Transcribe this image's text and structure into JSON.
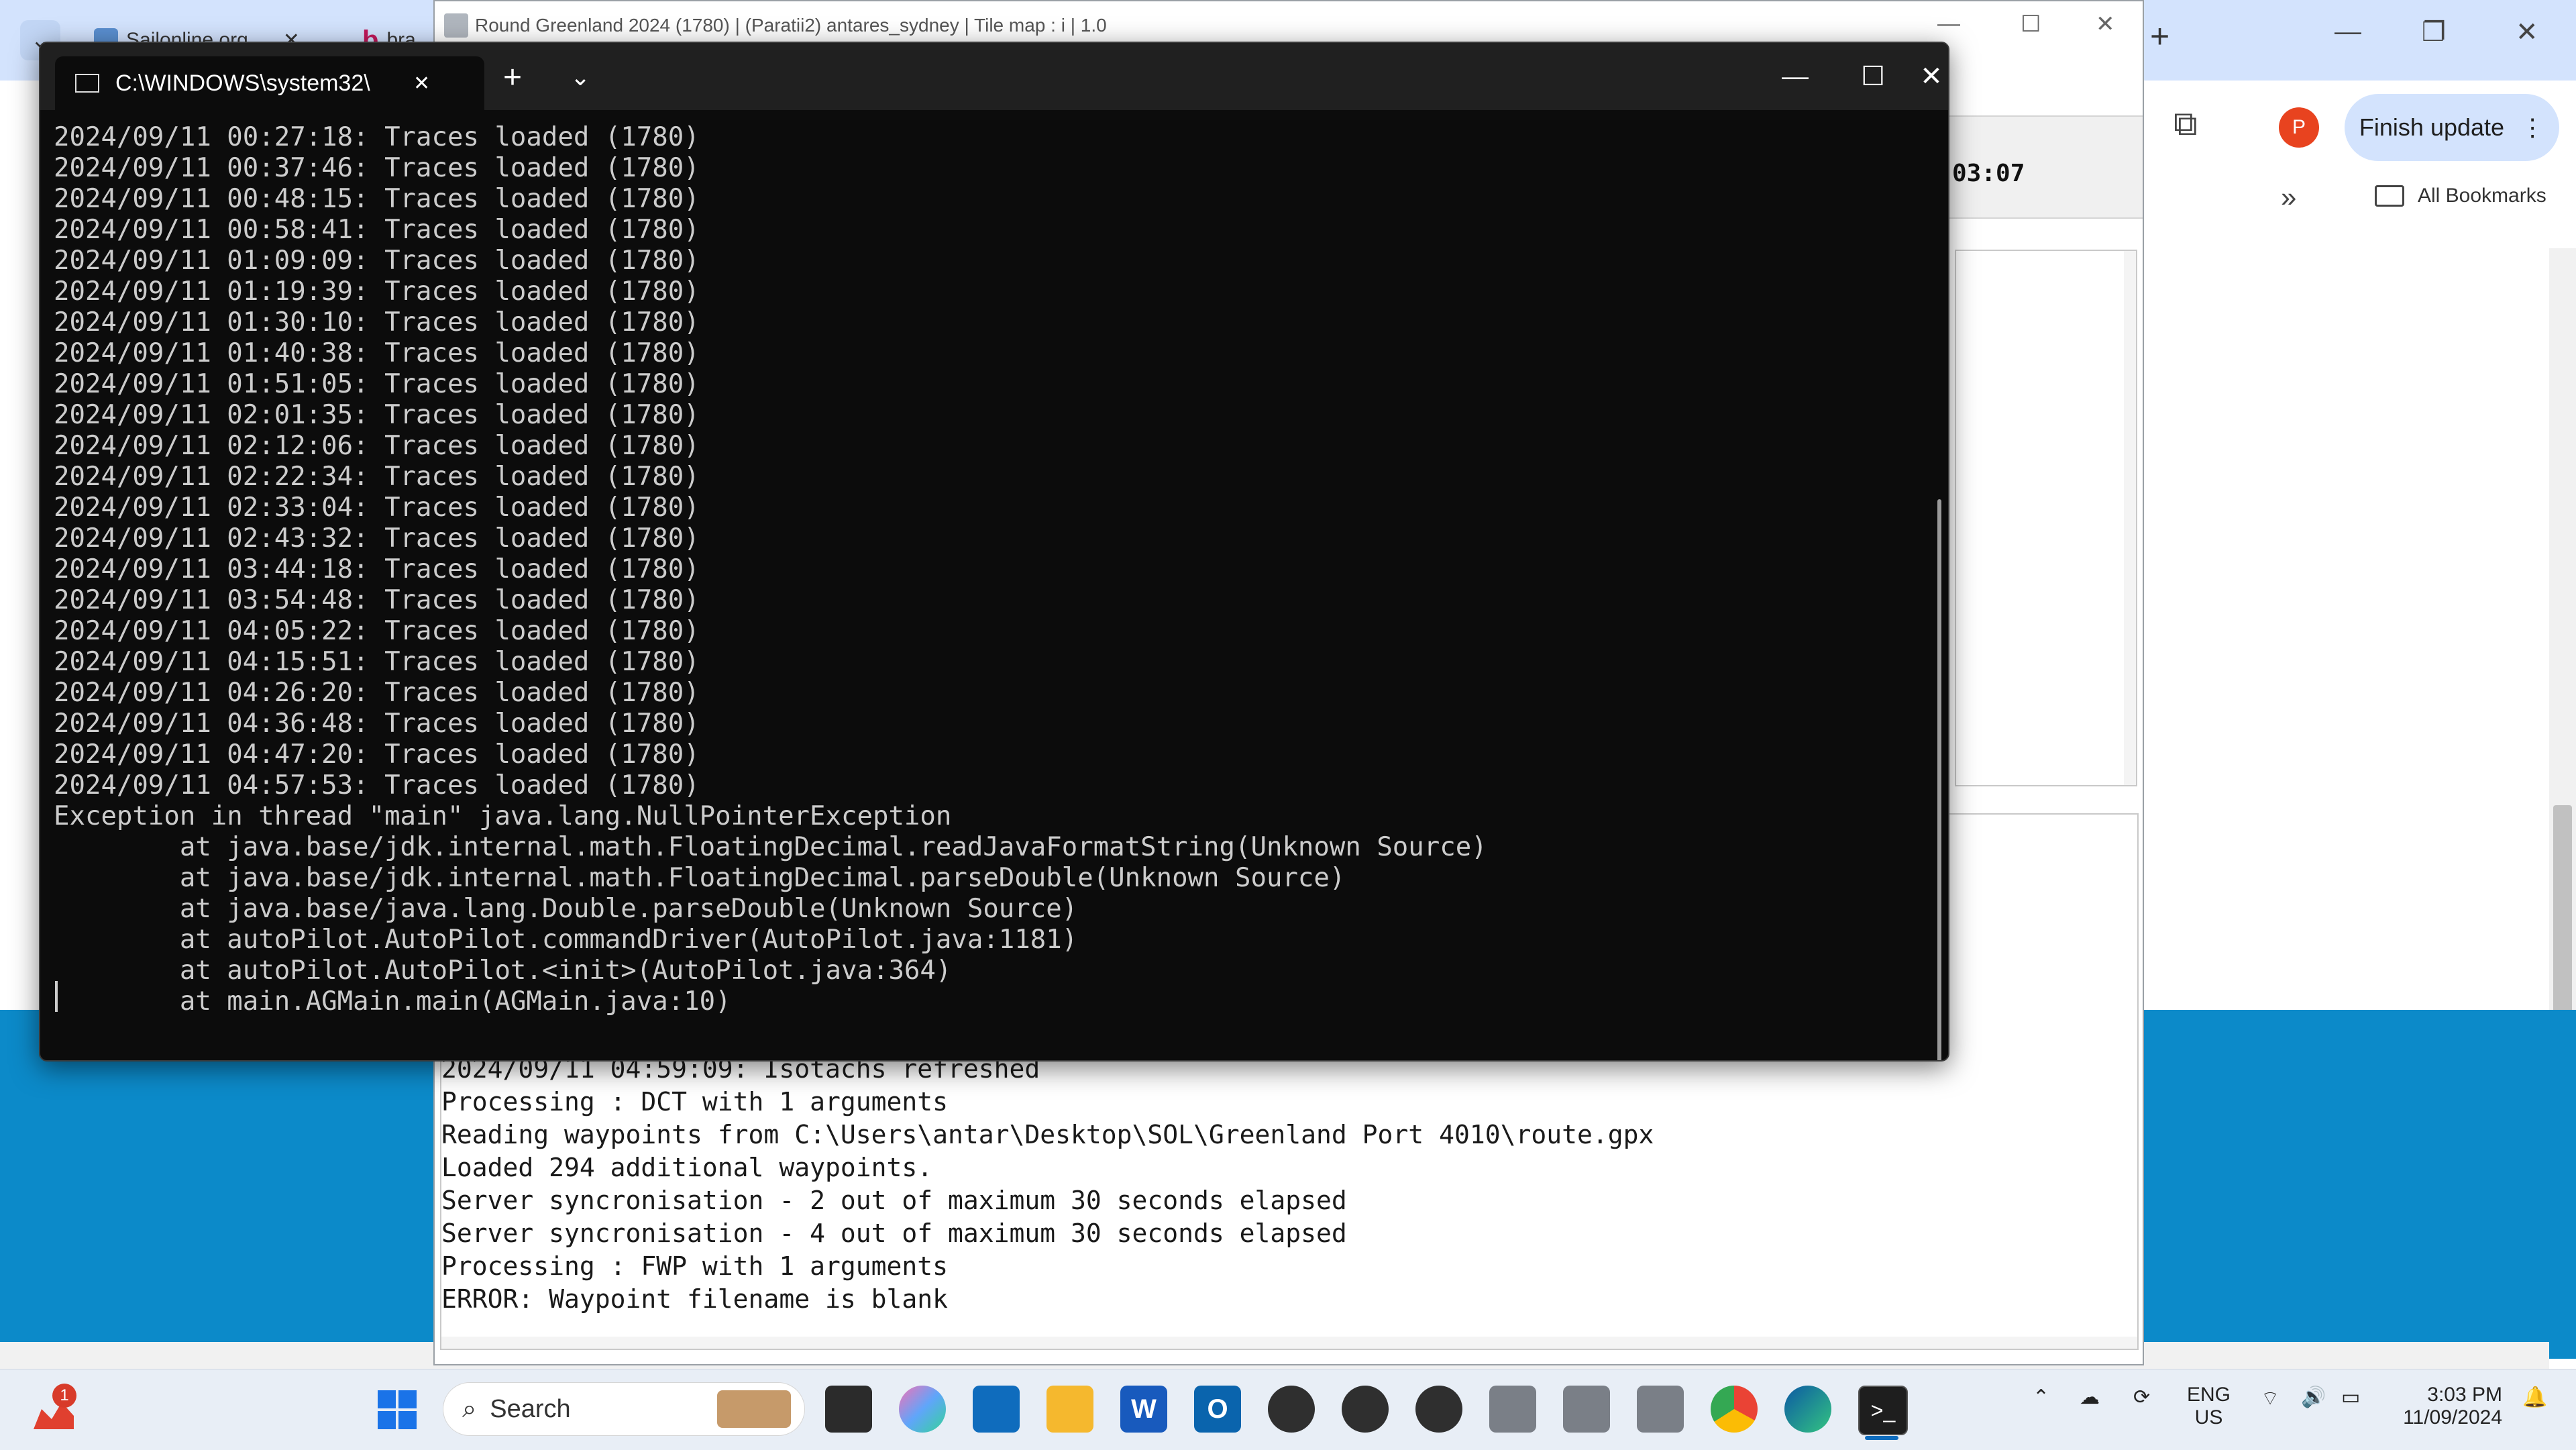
{
  "chrome": {
    "tab1": "Sailonline.org",
    "tab2": "bra",
    "finish_update": "Finish update",
    "avatar_letter": "P",
    "all_bookmarks": "All Bookmarks",
    "new_tab": "+"
  },
  "java_app": {
    "title": "Round Greenland 2024 (1780) | (Paratii2) antares_sydney | Tile map : i | 1.0",
    "clock": "03:07",
    "log_lines": [
      "2024/09/11 04:59:09: Isotachs refreshed",
      "Processing : DCT with 1 arguments",
      "Reading waypoints from C:\\Users\\antar\\Desktop\\SOL\\Greenland Port 4010\\route.gpx",
      "Loaded 294 additional waypoints.",
      "Server syncronisation - 2 out of maximum 30 seconds elapsed",
      "Server syncronisation - 4 out of maximum 30 seconds elapsed",
      "Processing : FWP with 1 arguments",
      "ERROR: Waypoint filename is blank"
    ]
  },
  "terminal": {
    "tab_title": "C:\\WINDOWS\\system32\\",
    "lines": [
      "2024/09/11 00:27:18: Traces loaded (1780)",
      "2024/09/11 00:37:46: Traces loaded (1780)",
      "2024/09/11 00:48:15: Traces loaded (1780)",
      "2024/09/11 00:58:41: Traces loaded (1780)",
      "2024/09/11 01:09:09: Traces loaded (1780)",
      "2024/09/11 01:19:39: Traces loaded (1780)",
      "2024/09/11 01:30:10: Traces loaded (1780)",
      "2024/09/11 01:40:38: Traces loaded (1780)",
      "2024/09/11 01:51:05: Traces loaded (1780)",
      "2024/09/11 02:01:35: Traces loaded (1780)",
      "2024/09/11 02:12:06: Traces loaded (1780)",
      "2024/09/11 02:22:34: Traces loaded (1780)",
      "2024/09/11 02:33:04: Traces loaded (1780)",
      "2024/09/11 02:43:32: Traces loaded (1780)",
      "2024/09/11 03:44:18: Traces loaded (1780)",
      "2024/09/11 03:54:48: Traces loaded (1780)",
      "2024/09/11 04:05:22: Traces loaded (1780)",
      "2024/09/11 04:15:51: Traces loaded (1780)",
      "2024/09/11 04:26:20: Traces loaded (1780)",
      "2024/09/11 04:36:48: Traces loaded (1780)",
      "2024/09/11 04:47:20: Traces loaded (1780)",
      "2024/09/11 04:57:53: Traces loaded (1780)",
      "Exception in thread \"main\" java.lang.NullPointerException",
      "        at java.base/jdk.internal.math.FloatingDecimal.readJavaFormatString(Unknown Source)",
      "        at java.base/jdk.internal.math.FloatingDecimal.parseDouble(Unknown Source)",
      "        at java.base/java.lang.Double.parseDouble(Unknown Source)",
      "        at autoPilot.AutoPilot.commandDriver(AutoPilot.java:1181)",
      "        at autoPilot.AutoPilot.<init>(AutoPilot.java:364)",
      "        at main.AGMain.main(AGMain.java:10)"
    ]
  },
  "taskbar": {
    "search_placeholder": "Search",
    "notification_count": "1",
    "lang_top": "ENG",
    "lang_bottom": "US",
    "time": "3:03 PM",
    "date": "11/09/2024"
  }
}
